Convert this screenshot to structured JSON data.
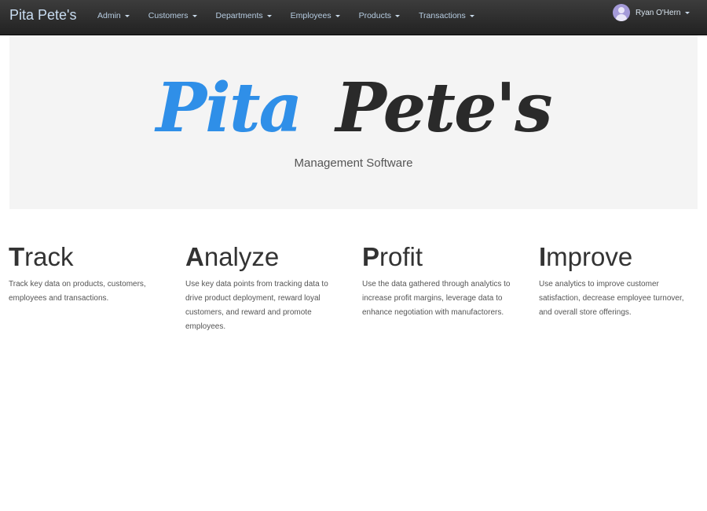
{
  "navbar": {
    "brand": "Pita Pete's",
    "menu": [
      {
        "label": "Admin"
      },
      {
        "label": "Customers"
      },
      {
        "label": "Departments"
      },
      {
        "label": "Employees"
      },
      {
        "label": "Products"
      },
      {
        "label": "Transactions"
      }
    ],
    "user": {
      "name": "Ryan O'Hern",
      "icon": "user-avatar-icon"
    }
  },
  "jumbotron": {
    "logo": {
      "word1": "Pita",
      "word2": "Pete's",
      "color1": "#2f8fe8",
      "color2": "#2a2a2a"
    },
    "subtitle": "Management Software"
  },
  "features": [
    {
      "first_letter": "T",
      "rest": "rack",
      "description": "Track key data on products, customers, employees and transactions."
    },
    {
      "first_letter": "A",
      "rest": "nalyze",
      "description": "Use key data points from tracking data to drive product deployment, reward loyal customers, and reward and promote employees."
    },
    {
      "first_letter": "P",
      "rest": "rofit",
      "description": "Use the data gathered through analytics to increase profit margins, leverage data to enhance negotiation with manufactorers."
    },
    {
      "first_letter": "I",
      "rest": "mprove",
      "description": "Use analytics to improve customer satisfaction, decrease employee turnover, and overall store offerings."
    }
  ]
}
